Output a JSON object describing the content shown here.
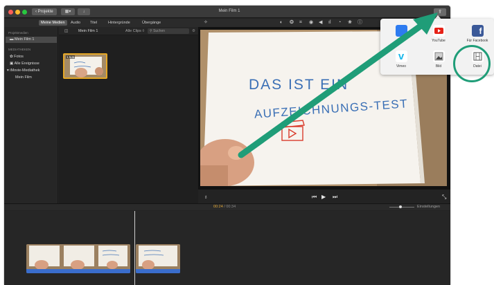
{
  "window": {
    "title": "Mein Film 1",
    "projects_button": "‹ Projekte"
  },
  "tabs": {
    "items": [
      "Meine Medien",
      "Audio",
      "Titel",
      "Hintergründe",
      "Übergänge"
    ],
    "active_index": 0
  },
  "sidebar": {
    "section_projects": "Projektmedien",
    "project_item": "Mein Film 1",
    "section_libraries": "MEDIATHEKEN",
    "items": [
      "Fotos",
      "Alle Ereignisse",
      "iMovie-Mediathek",
      "Mein Film"
    ]
  },
  "browser": {
    "project_label": "Mein Film 1",
    "filter_label": "Alle Clips ◊",
    "search_placeholder": "Suchen",
    "clip_duration": "1,5 m"
  },
  "viewer": {
    "handwriting_line1": "DAS  IST EIN",
    "handwriting_line2": "AUFZEICHNUNGS-TEST"
  },
  "timeline": {
    "current": "00:24",
    "separator": " / ",
    "total": "00:34",
    "settings_label": "Einstellungen"
  },
  "share_menu": {
    "items": [
      {
        "label": "Mail",
        "icon": "mail-icon",
        "color": "#2d7bf0"
      },
      {
        "label": "YouTube",
        "icon": "youtube-icon",
        "color": "#e62117"
      },
      {
        "label": "Für Facebook",
        "icon": "facebook-icon",
        "color": "#3b5998"
      },
      {
        "label": "Vimeo",
        "icon": "vimeo-icon",
        "color": "#1ab7ea"
      },
      {
        "label": "Bild",
        "icon": "image-icon",
        "color": "#555555"
      },
      {
        "label": "Datei",
        "icon": "file-icon",
        "color": "#666666"
      }
    ]
  },
  "colors": {
    "highlight": "#1f9d78",
    "selection": "#e6a825",
    "audio": "#3a6dcc",
    "timecode": "#e0a83a"
  }
}
